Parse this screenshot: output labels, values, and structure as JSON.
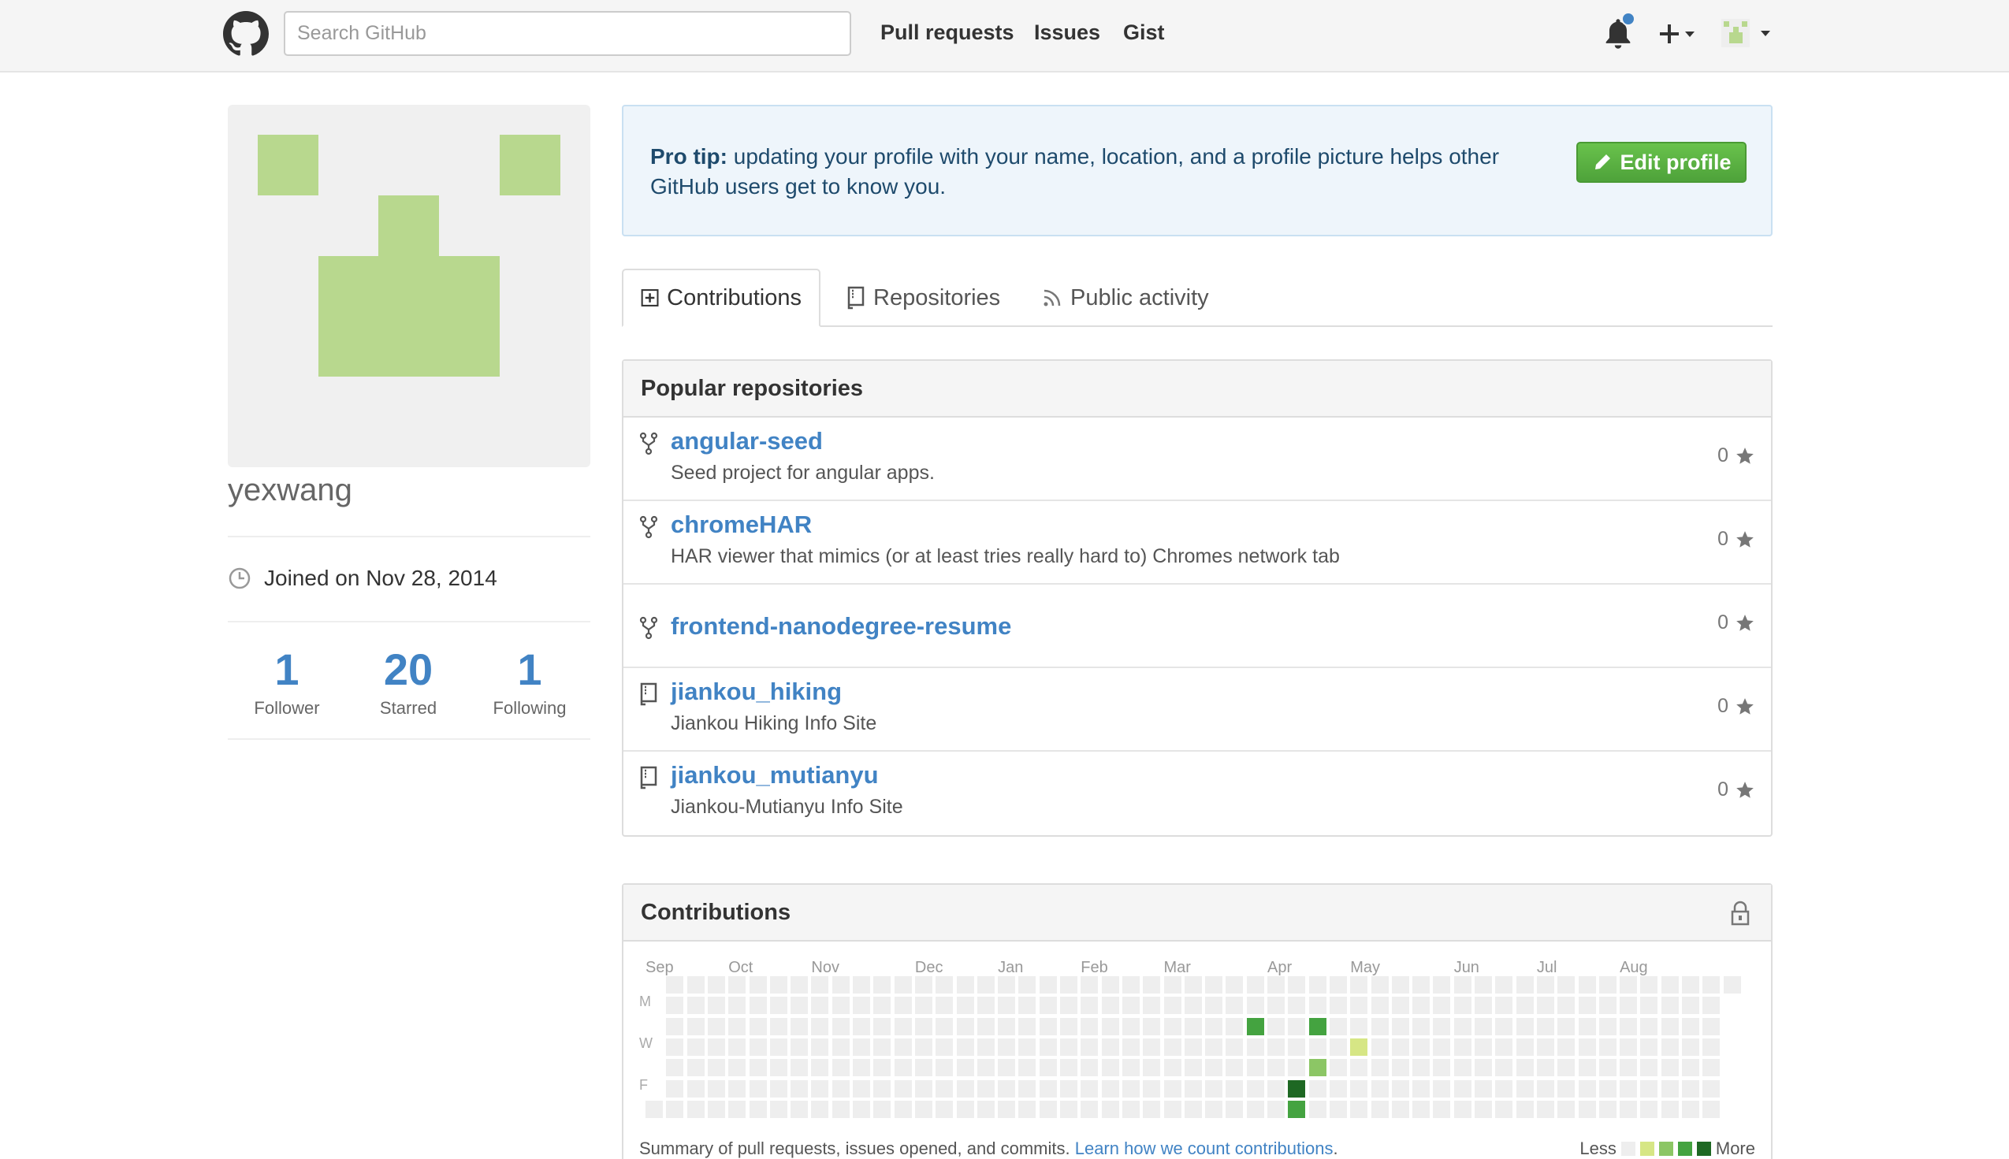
{
  "header": {
    "search_placeholder": "Search GitHub",
    "nav": [
      "Pull requests",
      "Issues",
      "Gist"
    ]
  },
  "profile": {
    "username": "yexwang",
    "joined": "Joined on Nov 28, 2014",
    "stats": [
      {
        "num": "1",
        "label": "Follower"
      },
      {
        "num": "20",
        "label": "Starred"
      },
      {
        "num": "1",
        "label": "Following"
      }
    ],
    "avatar_color": "#b8d88e"
  },
  "protip": {
    "bold": "Pro tip:",
    "text": " updating your profile with your name, location, and a profile picture helps other GitHub users get to know you.",
    "button": "Edit profile"
  },
  "tabs": [
    "Contributions",
    "Repositories",
    "Public activity"
  ],
  "popular": {
    "title": "Popular repositories",
    "repos": [
      {
        "name": "angular-seed",
        "desc": "Seed project for angular apps.",
        "stars": "0",
        "icon": "fork-icon"
      },
      {
        "name": "chromeHAR",
        "desc": "HAR viewer that mimics (or at least tries really hard to) Chromes network tab",
        "stars": "0",
        "icon": "fork-icon"
      },
      {
        "name": "frontend-nanodegree-resume",
        "desc": "",
        "stars": "0",
        "icon": "fork-icon"
      },
      {
        "name": "jiankou_hiking",
        "desc": "Jiankou Hiking Info Site",
        "stars": "0",
        "icon": "repo-icon"
      },
      {
        "name": "jiankou_mutianyu",
        "desc": "Jiankou-Mutianyu Info Site",
        "stars": "0",
        "icon": "repo-icon"
      }
    ]
  },
  "contributions": {
    "title": "Contributions",
    "months": [
      "Sep",
      "Oct",
      "Nov",
      "Dec",
      "Jan",
      "Feb",
      "Mar",
      "Apr",
      "May",
      "Jun",
      "Jul",
      "Aug"
    ],
    "days": [
      "M",
      "W",
      "F"
    ],
    "summary": "Summary of pull requests, issues opened, and commits.",
    "summary_link": "Learn how we count contributions",
    "legend_less": "Less",
    "legend_more": "More",
    "colors": [
      "#eeeeee",
      "#d6e685",
      "#8cc665",
      "#44a340",
      "#1e6823"
    ],
    "active": [
      {
        "week": 29,
        "day": 2,
        "level": 3
      },
      {
        "week": 32,
        "day": 2,
        "level": 3
      },
      {
        "week": 34,
        "day": 3,
        "level": 1
      },
      {
        "week": 32,
        "day": 4,
        "level": 2
      },
      {
        "week": 31,
        "day": 5,
        "level": 4
      },
      {
        "week": 31,
        "day": 6,
        "level": 3
      }
    ]
  }
}
